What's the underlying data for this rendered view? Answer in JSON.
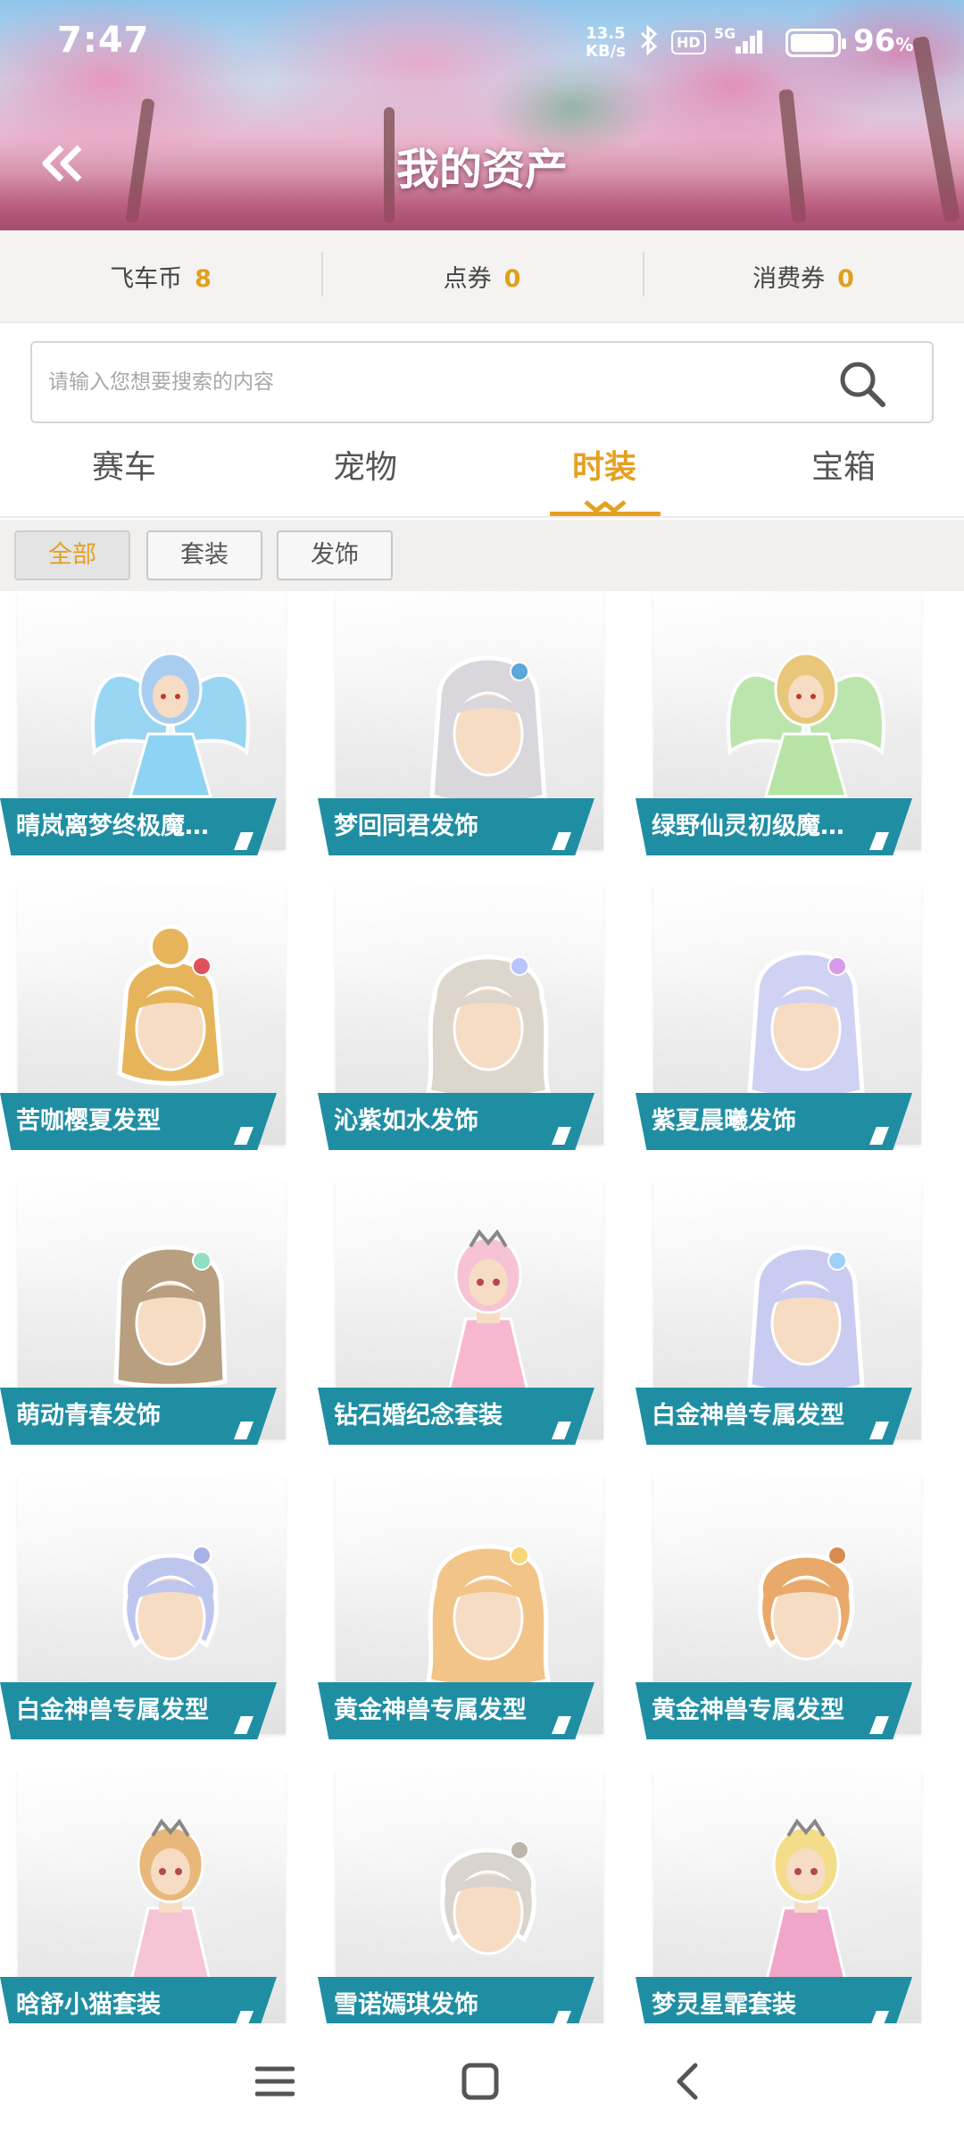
{
  "status_bar": {
    "time": "7:47",
    "net_speed_value": "13.5",
    "net_speed_unit": "KB/s",
    "hd_label": "HD",
    "network": "5G",
    "battery_percent": "96",
    "battery_symbol": "%",
    "battery_level": 0.96
  },
  "header": {
    "title": "我的资产"
  },
  "currency": [
    {
      "label": "飞车币",
      "value": "8"
    },
    {
      "label": "点券",
      "value": "0"
    },
    {
      "label": "消费券",
      "value": "0"
    }
  ],
  "search": {
    "placeholder": "请输入您想要搜索的内容",
    "value": ""
  },
  "tabs": [
    {
      "label": "赛车",
      "active": false
    },
    {
      "label": "宠物",
      "active": false
    },
    {
      "label": "时装",
      "active": true
    },
    {
      "label": "宝箱",
      "active": false
    }
  ],
  "filters": [
    {
      "label": "全部",
      "active": true
    },
    {
      "label": "套装",
      "active": false
    },
    {
      "label": "发饰",
      "active": false
    }
  ],
  "items": [
    {
      "name": "晴岚离梦终极魔…",
      "kind": "suit-wings",
      "hair": "#a9cdf0",
      "accent": "#8fd3f4"
    },
    {
      "name": "梦回同君发饰",
      "kind": "hair-long",
      "hair": "#d9d6dc",
      "accent": "#5ba7d8"
    },
    {
      "name": "绿野仙灵初级魔…",
      "kind": "suit-wings",
      "hair": "#e8c67a",
      "accent": "#b7e4a6"
    },
    {
      "name": "苦咖樱夏发型",
      "kind": "hair-bun",
      "hair": "#e6b45a",
      "accent": "#e0505a"
    },
    {
      "name": "沁紫如水发饰",
      "kind": "hair-wavy",
      "hair": "#dcd6cc",
      "accent": "#b9c4ff"
    },
    {
      "name": "紫夏晨曦发饰",
      "kind": "hair-long",
      "hair": "#cfd2f2",
      "accent": "#d99be8"
    },
    {
      "name": "萌动青春发饰",
      "kind": "hair-bangs",
      "hair": "#b79f80",
      "accent": "#8fe0c0"
    },
    {
      "name": "钻石婚纪念套装",
      "kind": "suit-girl",
      "hair": "#f5c3d4",
      "accent": "#f7b7cf"
    },
    {
      "name": "白金神兽专属发型",
      "kind": "hair-long",
      "hair": "#c9ccf0",
      "accent": "#9fd0f7"
    },
    {
      "name": "白金神兽专属发型",
      "kind": "hair-short",
      "hair": "#bfc6ee",
      "accent": "#a8b0e8"
    },
    {
      "name": "黄金神兽专属发型",
      "kind": "hair-wavy",
      "hair": "#f2c487",
      "accent": "#f5d77a"
    },
    {
      "name": "黄金神兽专属发型",
      "kind": "hair-short",
      "hair": "#e8a96a",
      "accent": "#d98b4c"
    },
    {
      "name": "晗舒小猫套装",
      "kind": "suit-girl",
      "hair": "#e8b77a",
      "accent": "#f5c5d6"
    },
    {
      "name": "雪诺嫣琪发饰",
      "kind": "hair-short",
      "hair": "#d9d4cd",
      "accent": "#bdb6ad"
    },
    {
      "name": "梦灵星霏套装",
      "kind": "suit-girl",
      "hair": "#f3dc8a",
      "accent": "#f0a6c9"
    }
  ],
  "colors": {
    "accent": "#e5a021",
    "label_bg": "#1f8ea3"
  },
  "nav": {
    "menu_icon": "menu-icon",
    "home_icon": "home-icon",
    "back_icon": "back-icon"
  }
}
